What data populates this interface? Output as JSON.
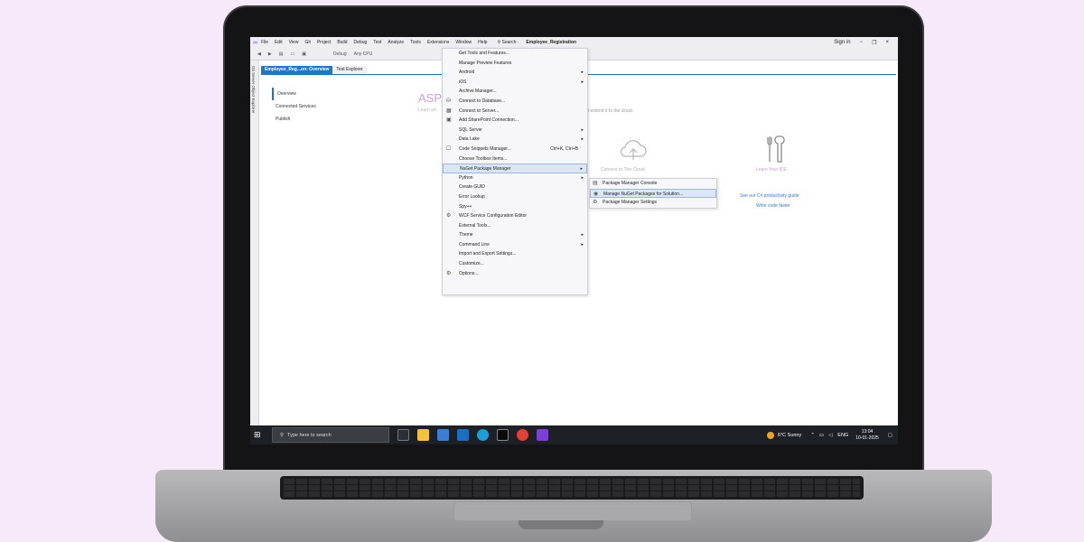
{
  "menubar": {
    "logo": "∞",
    "items": [
      "File",
      "Edit",
      "View",
      "Git",
      "Project",
      "Build",
      "Debug",
      "Test",
      "Analyze",
      "Tools",
      "Extensions",
      "Window",
      "Help"
    ],
    "search_label": "⚲ Search ·",
    "solution_title": "Employee_Registration",
    "sign_in": "Sign in",
    "window_controls": [
      "−",
      "❐",
      "×"
    ]
  },
  "toolbar": {
    "config": "Debug",
    "platform": "Any CPU"
  },
  "left_vertical_tabs": "Git Server Object Explorer",
  "doc_tabs": {
    "active": "Employee_Reg...on: Overview",
    "other": "Test Explorer"
  },
  "overview_nav": [
    "Overview",
    "Connected Services",
    "Publish"
  ],
  "page": {
    "heading_partial": "ASP.",
    "sub_partial": "Learn ab",
    "extend_text": "l extend it to the cloud.",
    "cloud_card": "Connect to The Cloud",
    "ide_card": "Learn Your IDE",
    "link1": "See our C# productivity guide",
    "link2": "Write code faster"
  },
  "tools_menu": [
    {
      "label": "Get Tools and Features...",
      "icon": "",
      "arrow": false
    },
    {
      "label": "Manage Preview Features",
      "icon": "",
      "arrow": false
    },
    {
      "label": "Android",
      "icon": "",
      "arrow": true
    },
    {
      "label": "iOS",
      "icon": "",
      "arrow": true
    },
    {
      "label": "Archive Manager...",
      "icon": "",
      "arrow": false
    },
    {
      "label": "Connect to Database...",
      "icon": "⛁",
      "arrow": false
    },
    {
      "label": "Connect to Server...",
      "icon": "▦",
      "arrow": false
    },
    {
      "label": "Add SharePoint Connection...",
      "icon": "▣",
      "arrow": false
    },
    {
      "label": "SQL Server",
      "icon": "",
      "arrow": true
    },
    {
      "label": "Data Lake",
      "icon": "",
      "arrow": true
    },
    {
      "label": "Code Snippets Manager...",
      "icon": "☐",
      "arrow": false,
      "shortcut": "Ctrl+K, Ctrl+B"
    },
    {
      "label": "Choose Toolbox Items...",
      "icon": "",
      "arrow": false
    },
    {
      "label": "NuGet Package Manager",
      "icon": "",
      "arrow": true,
      "selected": true
    },
    {
      "label": "Python",
      "icon": "",
      "arrow": true
    },
    {
      "label": "Create GUID",
      "icon": "",
      "arrow": false
    },
    {
      "label": "Error Lookup",
      "icon": "",
      "arrow": false
    },
    {
      "label": "Spy++",
      "icon": "",
      "arrow": false
    },
    {
      "label": "WCF Service Configuration Editor",
      "icon": "⚙",
      "arrow": false
    },
    {
      "label": "External Tools...",
      "icon": "",
      "arrow": false
    },
    {
      "label": "Theme",
      "icon": "",
      "arrow": true
    },
    {
      "label": "Command Line",
      "icon": "",
      "arrow": true
    },
    {
      "label": "Import and Export Settings...",
      "icon": "",
      "arrow": false
    },
    {
      "label": "Customize...",
      "icon": "",
      "arrow": false
    },
    {
      "label": "Options...",
      "icon": "⚙",
      "arrow": false
    }
  ],
  "nuget_submenu": [
    {
      "label": "Package Manager Console",
      "icon": "▤"
    },
    {
      "label": "Manage NuGet Packages for Solution...",
      "icon": "◉",
      "selected": true
    },
    {
      "label": "Package Manager Settings",
      "icon": "⚙"
    }
  ],
  "taskbar": {
    "search_placeholder": "Type here to search",
    "weather": "6°C  Sunny",
    "lang": "ENG",
    "time": "13:04",
    "date": "10-01-2025"
  },
  "colors": {
    "accent": "#1f76c7",
    "vs_purple": "#7c3fd8",
    "background": "#f6e9fa"
  }
}
